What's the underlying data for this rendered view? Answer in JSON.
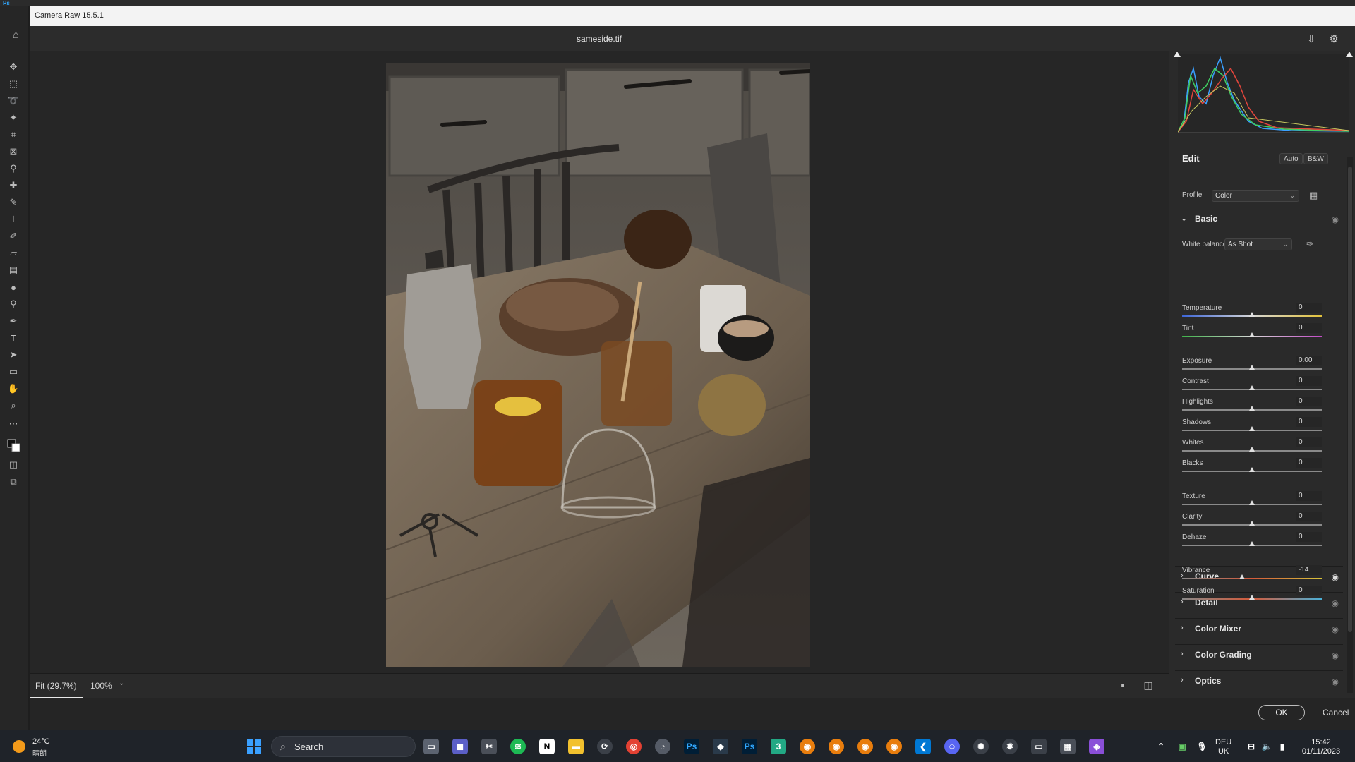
{
  "app": {
    "ps_logo": "Ps"
  },
  "dialog": {
    "title": "Camera Raw 15.5.1",
    "filename": "sameside.tif"
  },
  "zoom": {
    "fit_label": "Fit (29.7%)",
    "zoom_100": "100%"
  },
  "footer": {
    "ok_label": "OK",
    "cancel_label": "Cancel"
  },
  "panel": {
    "edit_title": "Edit",
    "auto_label": "Auto",
    "bw_label": "B&W",
    "profile_label": "Profile",
    "profile_value": "Color",
    "basic_title": "Basic",
    "white_balance_label": "White balance",
    "white_balance_value": "As Shot",
    "sliders": [
      {
        "label": "Temperature",
        "value": "0",
        "position": 0.5
      },
      {
        "label": "Tint",
        "value": "0",
        "position": 0.5
      },
      {
        "label": "Exposure",
        "value": "0.00",
        "position": 0.5
      },
      {
        "label": "Contrast",
        "value": "0",
        "position": 0.5
      },
      {
        "label": "Highlights",
        "value": "0",
        "position": 0.5
      },
      {
        "label": "Shadows",
        "value": "0",
        "position": 0.5
      },
      {
        "label": "Whites",
        "value": "0",
        "position": 0.5
      },
      {
        "label": "Blacks",
        "value": "0",
        "position": 0.5
      },
      {
        "label": "Texture",
        "value": "0",
        "position": 0.5
      },
      {
        "label": "Clarity",
        "value": "0",
        "position": 0.5
      },
      {
        "label": "Dehaze",
        "value": "0",
        "position": 0.5
      },
      {
        "label": "Vibrance",
        "value": "-14",
        "position": 0.43
      },
      {
        "label": "Saturation",
        "value": "0",
        "position": 0.5
      }
    ],
    "sections": [
      "Curve",
      "Detail",
      "Color Mixer",
      "Color Grading",
      "Optics"
    ]
  },
  "taskbar": {
    "temperature": "24°C",
    "condition": "晴朗",
    "search_placeholder": "Search",
    "lang_top": "DEU",
    "lang_bottom": "UK",
    "time": "15:42",
    "date": "01/11/2023"
  },
  "colors": {
    "accent": "#31a8ff",
    "panel_bg": "#2a2a2a",
    "canvas_bg": "#262626",
    "taskbar_bg": "#1f2329"
  }
}
